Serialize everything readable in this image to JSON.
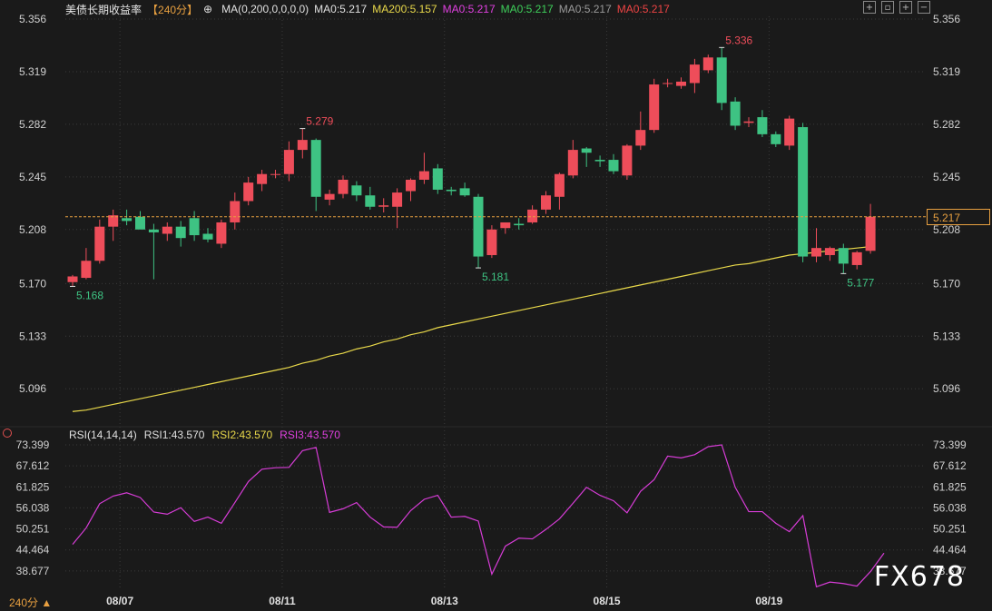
{
  "header": {
    "title": "美债长期收益率",
    "period": "【240分】",
    "ma_title": "MA(0,200,0,0,0,0)",
    "ma_values": [
      {
        "label": "MA0:5.217",
        "color": "#e0e0e0"
      },
      {
        "label": "MA200:5.157",
        "color": "#e8d84a"
      },
      {
        "label": "MA0:5.217",
        "color": "#e040e0"
      },
      {
        "label": "MA0:5.217",
        "color": "#3ecf5a"
      },
      {
        "label": "MA0:5.217",
        "color": "#9a9a9a"
      },
      {
        "label": "MA0:5.217",
        "color": "#ee4444"
      }
    ]
  },
  "rsi_header": {
    "title": "RSI(14,14,14)",
    "rsi1": "RSI1:43.570",
    "rsi2": "RSI2:43.570",
    "rsi3": "RSI3:43.570"
  },
  "current_price_label": "5.217",
  "period_selector": "240分 ▲",
  "watermark": "FX678",
  "colors": {
    "up": "#ee4d5a",
    "down": "#3ec383",
    "ma200": "#e8d84a",
    "rsi": "#d63cd6",
    "grid": "#3a3a3a",
    "dash": "#e8a040"
  },
  "chart_data": [
    {
      "type": "candlestick",
      "title": "美债长期收益率",
      "ylim": [
        5.08,
        5.36
      ],
      "yticks": [
        "5.356",
        "5.319",
        "5.282",
        "5.245",
        "5.208",
        "5.170",
        "5.133",
        "5.096"
      ],
      "xticks": [
        {
          "label": "08/07",
          "index": 3
        },
        {
          "label": "08/11",
          "index": 15
        },
        {
          "label": "08/13",
          "index": 27
        },
        {
          "label": "08/15",
          "index": 39
        },
        {
          "label": "08/19",
          "index": 51
        }
      ],
      "candles": [
        {
          "o": 5.171,
          "h": 5.176,
          "l": 5.168,
          "c": 5.175
        },
        {
          "o": 5.174,
          "h": 5.195,
          "l": 5.173,
          "c": 5.186
        },
        {
          "o": 5.186,
          "h": 5.215,
          "l": 5.184,
          "c": 5.21
        },
        {
          "o": 5.21,
          "h": 5.222,
          "l": 5.2,
          "c": 5.218
        },
        {
          "o": 5.216,
          "h": 5.222,
          "l": 5.211,
          "c": 5.214
        },
        {
          "o": 5.217,
          "h": 5.221,
          "l": 5.211,
          "c": 5.208
        },
        {
          "o": 5.208,
          "h": 5.212,
          "l": 5.173,
          "c": 5.206
        },
        {
          "o": 5.205,
          "h": 5.213,
          "l": 5.2,
          "c": 5.21
        },
        {
          "o": 5.21,
          "h": 5.214,
          "l": 5.196,
          "c": 5.202
        },
        {
          "o": 5.216,
          "h": 5.221,
          "l": 5.2,
          "c": 5.204
        },
        {
          "o": 5.205,
          "h": 5.209,
          "l": 5.199,
          "c": 5.201
        },
        {
          "o": 5.198,
          "h": 5.215,
          "l": 5.195,
          "c": 5.213
        },
        {
          "o": 5.213,
          "h": 5.234,
          "l": 5.208,
          "c": 5.228
        },
        {
          "o": 5.228,
          "h": 5.245,
          "l": 5.225,
          "c": 5.241
        },
        {
          "o": 5.24,
          "h": 5.25,
          "l": 5.235,
          "c": 5.247
        },
        {
          "o": 5.247,
          "h": 5.25,
          "l": 5.244,
          "c": 5.247
        },
        {
          "o": 5.247,
          "h": 5.27,
          "l": 5.242,
          "c": 5.264
        },
        {
          "o": 5.264,
          "h": 5.279,
          "l": 5.258,
          "c": 5.271
        },
        {
          "o": 5.271,
          "h": 5.272,
          "l": 5.221,
          "c": 5.231
        },
        {
          "o": 5.229,
          "h": 5.236,
          "l": 5.225,
          "c": 5.233
        },
        {
          "o": 5.233,
          "h": 5.246,
          "l": 5.23,
          "c": 5.243
        },
        {
          "o": 5.239,
          "h": 5.242,
          "l": 5.228,
          "c": 5.232
        },
        {
          "o": 5.232,
          "h": 5.238,
          "l": 5.222,
          "c": 5.224
        },
        {
          "o": 5.224,
          "h": 5.23,
          "l": 5.22,
          "c": 5.225
        },
        {
          "o": 5.224,
          "h": 5.237,
          "l": 5.209,
          "c": 5.234
        },
        {
          "o": 5.235,
          "h": 5.244,
          "l": 5.228,
          "c": 5.243
        },
        {
          "o": 5.243,
          "h": 5.262,
          "l": 5.24,
          "c": 5.249
        },
        {
          "o": 5.251,
          "h": 5.254,
          "l": 5.233,
          "c": 5.236
        },
        {
          "o": 5.236,
          "h": 5.238,
          "l": 5.232,
          "c": 5.235
        },
        {
          "o": 5.237,
          "h": 5.241,
          "l": 5.231,
          "c": 5.232
        },
        {
          "o": 5.231,
          "h": 5.233,
          "l": 5.181,
          "c": 5.189
        },
        {
          "o": 5.19,
          "h": 5.211,
          "l": 5.188,
          "c": 5.208
        },
        {
          "o": 5.209,
          "h": 5.213,
          "l": 5.205,
          "c": 5.213
        },
        {
          "o": 5.212,
          "h": 5.216,
          "l": 5.208,
          "c": 5.211
        },
        {
          "o": 5.213,
          "h": 5.225,
          "l": 5.212,
          "c": 5.222
        },
        {
          "o": 5.222,
          "h": 5.235,
          "l": 5.219,
          "c": 5.232
        },
        {
          "o": 5.231,
          "h": 5.248,
          "l": 5.222,
          "c": 5.247
        },
        {
          "o": 5.246,
          "h": 5.271,
          "l": 5.244,
          "c": 5.264
        },
        {
          "o": 5.265,
          "h": 5.266,
          "l": 5.252,
          "c": 5.262
        },
        {
          "o": 5.257,
          "h": 5.26,
          "l": 5.252,
          "c": 5.256
        },
        {
          "o": 5.257,
          "h": 5.261,
          "l": 5.247,
          "c": 5.249
        },
        {
          "o": 5.246,
          "h": 5.268,
          "l": 5.243,
          "c": 5.267
        },
        {
          "o": 5.267,
          "h": 5.291,
          "l": 5.264,
          "c": 5.278
        },
        {
          "o": 5.278,
          "h": 5.314,
          "l": 5.276,
          "c": 5.31
        },
        {
          "o": 5.311,
          "h": 5.314,
          "l": 5.308,
          "c": 5.311
        },
        {
          "o": 5.309,
          "h": 5.315,
          "l": 5.307,
          "c": 5.312
        },
        {
          "o": 5.311,
          "h": 5.328,
          "l": 5.304,
          "c": 5.324
        },
        {
          "o": 5.32,
          "h": 5.331,
          "l": 5.318,
          "c": 5.329
        },
        {
          "o": 5.329,
          "h": 5.336,
          "l": 5.292,
          "c": 5.297
        },
        {
          "o": 5.298,
          "h": 5.301,
          "l": 5.278,
          "c": 5.281
        },
        {
          "o": 5.283,
          "h": 5.287,
          "l": 5.28,
          "c": 5.284
        },
        {
          "o": 5.287,
          "h": 5.292,
          "l": 5.273,
          "c": 5.275
        },
        {
          "o": 5.275,
          "h": 5.277,
          "l": 5.266,
          "c": 5.268
        },
        {
          "o": 5.267,
          "h": 5.288,
          "l": 5.264,
          "c": 5.286
        },
        {
          "o": 5.28,
          "h": 5.283,
          "l": 5.185,
          "c": 5.189
        },
        {
          "o": 5.189,
          "h": 5.209,
          "l": 5.185,
          "c": 5.195
        },
        {
          "o": 5.19,
          "h": 5.196,
          "l": 5.186,
          "c": 5.195
        },
        {
          "o": 5.195,
          "h": 5.198,
          "l": 5.177,
          "c": 5.184
        },
        {
          "o": 5.183,
          "h": 5.193,
          "l": 5.18,
          "c": 5.192
        },
        {
          "o": 5.193,
          "h": 5.226,
          "l": 5.191,
          "c": 5.217
        }
      ],
      "annotations": [
        {
          "text": "5.168",
          "index": 0,
          "value": 5.168,
          "pos": "below",
          "color": "#3ec383"
        },
        {
          "text": "5.279",
          "index": 17,
          "value": 5.279,
          "pos": "above",
          "color": "#ee4d5a"
        },
        {
          "text": "5.181",
          "index": 30,
          "value": 5.181,
          "pos": "below",
          "color": "#3ec383"
        },
        {
          "text": "5.336",
          "index": 48,
          "value": 5.336,
          "pos": "above",
          "color": "#ee4d5a"
        },
        {
          "text": "5.177",
          "index": 57,
          "value": 5.177,
          "pos": "below",
          "color": "#3ec383"
        }
      ],
      "current_price": 5.217,
      "ma200": [
        5.08,
        5.081,
        5.083,
        5.085,
        5.087,
        5.089,
        5.091,
        5.093,
        5.095,
        5.097,
        5.099,
        5.101,
        5.103,
        5.105,
        5.107,
        5.109,
        5.111,
        5.114,
        5.116,
        5.119,
        5.121,
        5.124,
        5.126,
        5.129,
        5.131,
        5.134,
        5.136,
        5.139,
        5.141,
        5.143,
        5.145,
        5.147,
        5.149,
        5.151,
        5.153,
        5.155,
        5.157,
        5.159,
        5.161,
        5.163,
        5.165,
        5.167,
        5.169,
        5.171,
        5.173,
        5.175,
        5.177,
        5.179,
        5.181,
        5.183,
        5.184,
        5.186,
        5.188,
        5.19,
        5.191,
        5.192,
        5.193,
        5.194,
        5.195,
        5.196
      ]
    },
    {
      "type": "line",
      "title": "RSI(14,14,14)",
      "ylim": [
        32.89,
        73.399
      ],
      "yticks": [
        "73.399",
        "67.612",
        "61.825",
        "56.038",
        "50.251",
        "44.464",
        "38.677"
      ],
      "series": [
        {
          "name": "RSI1",
          "values": [
            46.0,
            50.5,
            57.2,
            59.3,
            60.2,
            58.9,
            54.9,
            54.3,
            56.1,
            52.3,
            53.5,
            51.8,
            57.5,
            63.3,
            66.7,
            67.1,
            67.2,
            71.8,
            72.7,
            54.8,
            55.8,
            57.5,
            53.5,
            50.8,
            50.7,
            55.3,
            58.4,
            59.5,
            53.5,
            53.7,
            52.4,
            37.8,
            45.5,
            47.7,
            47.5,
            50.1,
            53.0,
            57.3,
            61.7,
            59.5,
            58.0,
            54.7,
            60.6,
            63.8,
            70.3,
            69.8,
            70.7,
            72.9,
            73.4,
            61.7,
            55.0,
            55.0,
            51.8,
            49.5,
            53.9,
            34.3,
            35.6,
            35.2,
            34.5,
            38.5,
            43.57
          ]
        }
      ]
    }
  ]
}
